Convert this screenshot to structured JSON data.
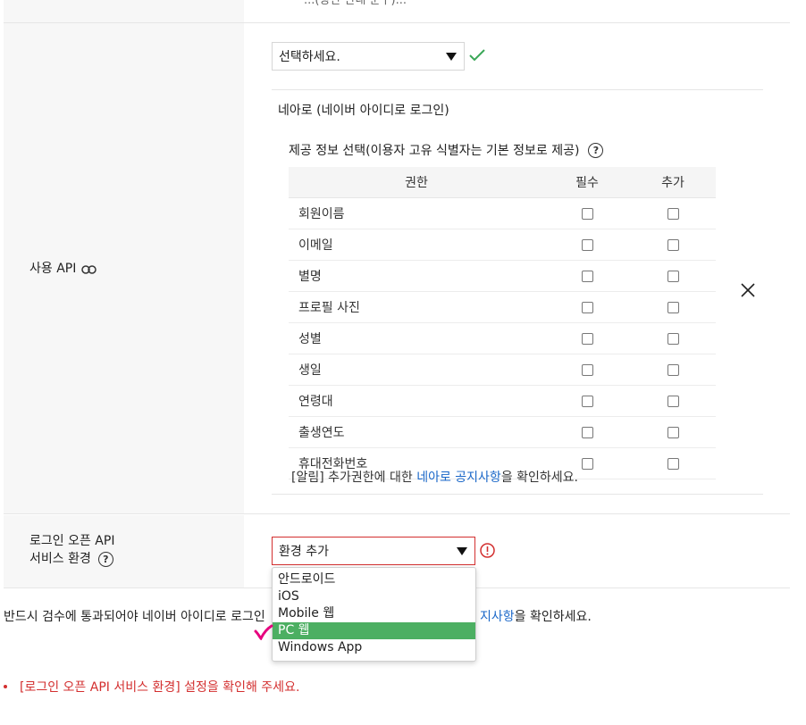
{
  "top_cut_text": "...(상단 안내 문구)...",
  "row_api": {
    "label": "사용 API",
    "link_icon": "link-icon",
    "select_value": "선택하세요.",
    "check_icon": "check-icon",
    "api_name": "네아로 (네이버 아이디로 로그인)",
    "provide_info_title": "제공 정보 선택(이용자 고유 식별자는 기본 정보로 제공)",
    "help_icon": "question-circle-icon",
    "table": {
      "headers": [
        "권한",
        "필수",
        "추가"
      ],
      "rows": [
        "회원이름",
        "이메일",
        "별명",
        "프로필 사진",
        "성별",
        "생일",
        "연령대",
        "출생연도",
        "휴대전화번호"
      ]
    },
    "notice_prefix": "[알림] 추가권한에 대한 ",
    "notice_link": "네아로 공지사항",
    "notice_suffix": "을 확인하세요.",
    "close_icon": "close-icon"
  },
  "row_env": {
    "label_line1": "로그인 오픈 API",
    "label_line2": "서비스 환경",
    "help_icon": "question-circle-icon",
    "select_value": "환경 추가",
    "error_icon": "exclamation-circle-icon",
    "error_color": "#d32f2f",
    "dropdown_options": [
      "안드로이드",
      "iOS",
      "Mobile 웹",
      "PC 웹",
      "Windows App"
    ],
    "selected_option": "PC 웹",
    "highlight_color": "#4caf62"
  },
  "bottom_notice": {
    "prefix": "반드시 검수에 통과되어야 네이버 아이디로 로그인",
    "link": "지사항",
    "suffix": "을 확인하세요."
  },
  "error_message": "[로그인 오픈 API 서비스 환경] 설정을 확인해 주세요.",
  "annotation_mark": "checkmark-annotation",
  "annotation_color": "#e6007e"
}
